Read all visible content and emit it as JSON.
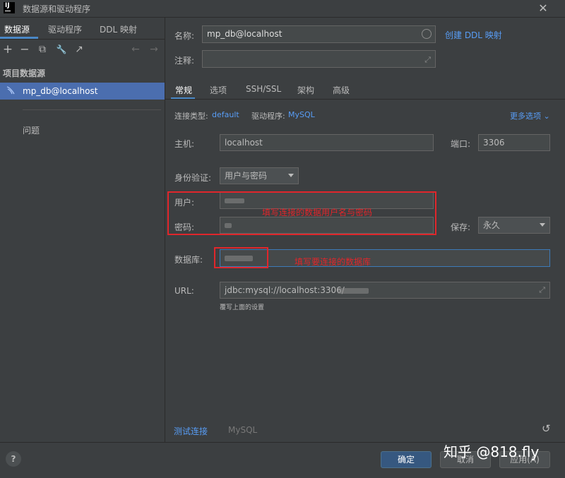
{
  "window": {
    "title": "数据源和驱动程序"
  },
  "left": {
    "tabs": [
      "数据源",
      "驱动程序",
      "DDL 映射"
    ],
    "toolbar": {
      "add": "+",
      "remove": "−",
      "copy": "⧉",
      "settings": "🔧",
      "jump": "↗",
      "back": "←",
      "forward": "→"
    },
    "section": "项目数据源",
    "datasource": "mp_db@localhost",
    "problems": "问题"
  },
  "form": {
    "name_label": "名称:",
    "name_value": "mp_db@localhost",
    "create_ddl": "创建 DDL 映射",
    "comment_label": "注释:",
    "tabs": [
      "常规",
      "选项",
      "SSH/SSL",
      "架构",
      "高级"
    ],
    "conn_type_label": "连接类型:",
    "conn_type_value": "default",
    "driver_label": "驱动程序:",
    "driver_value": "MySQL",
    "more_options": "更多选项",
    "host_label": "主机:",
    "host_value": "localhost",
    "port_label": "端口:",
    "port_value": "3306",
    "auth_label": "身份验证:",
    "auth_value": "用户与密码",
    "user_label": "用户:",
    "password_label": "密码:",
    "save_label": "保存:",
    "save_value": "永久",
    "database_label": "数据库:",
    "url_label": "URL:",
    "url_value": "jdbc:mysql://localhost:3306/",
    "url_hint": "覆写上面的设置",
    "test_connection": "测试连接",
    "driver_footer": "MySQL"
  },
  "annotations": {
    "user_password": "填写连接的数据用户名与密码",
    "database": "填写要连接的数据库"
  },
  "buttons": {
    "ok": "确定",
    "cancel": "取消",
    "apply": "应用(A)",
    "help": "?"
  },
  "watermark": "知乎 @818.fly"
}
